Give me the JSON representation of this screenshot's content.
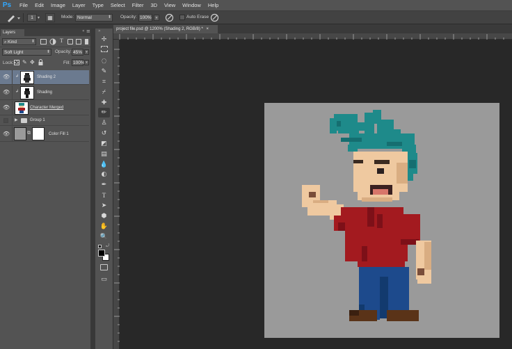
{
  "app": {
    "logo": "Ps"
  },
  "menu": [
    "File",
    "Edit",
    "Image",
    "Layer",
    "Type",
    "Select",
    "Filter",
    "3D",
    "View",
    "Window",
    "Help"
  ],
  "options": {
    "brush_size": "1",
    "mode_label": "Mode:",
    "mode_value": "Normal",
    "opacity_label": "Opacity:",
    "opacity_value": "100%",
    "auto_erase_label": "Auto Erase"
  },
  "layers_panel": {
    "tab": "Layers",
    "filter_value": "Kind",
    "blend_mode": "Soft Light",
    "opacity_label": "Opacity:",
    "opacity_value": "45%",
    "lock_label": "Lock:",
    "fill_label": "Fill:",
    "fill_value": "100%",
    "layers": [
      {
        "name": "Shading 2",
        "selected": true,
        "visible": true
      },
      {
        "name": "Shading",
        "selected": false,
        "visible": true
      },
      {
        "name": "Character Merged",
        "selected": false,
        "visible": true
      },
      {
        "name": "Group 1",
        "selected": false,
        "visible": false
      },
      {
        "name": "Color Fill 1",
        "selected": false,
        "visible": true
      }
    ]
  },
  "document": {
    "tab_title": "project file.psd @ 1200% (Shading 2, RGB/8) *",
    "close_glyph": "×"
  },
  "colors": {
    "canvas_bg": "#9a9a9a",
    "hair": "#1e8a8a",
    "skin": "#efc9a0",
    "shirt": "#a31a1f",
    "pants": "#1d4a8c",
    "shoes": "#5a3318",
    "selection": "#6b7a8f"
  },
  "icons": {
    "pencil": "pencil-icon",
    "eye": "eye-icon",
    "folder": "folder-icon"
  }
}
